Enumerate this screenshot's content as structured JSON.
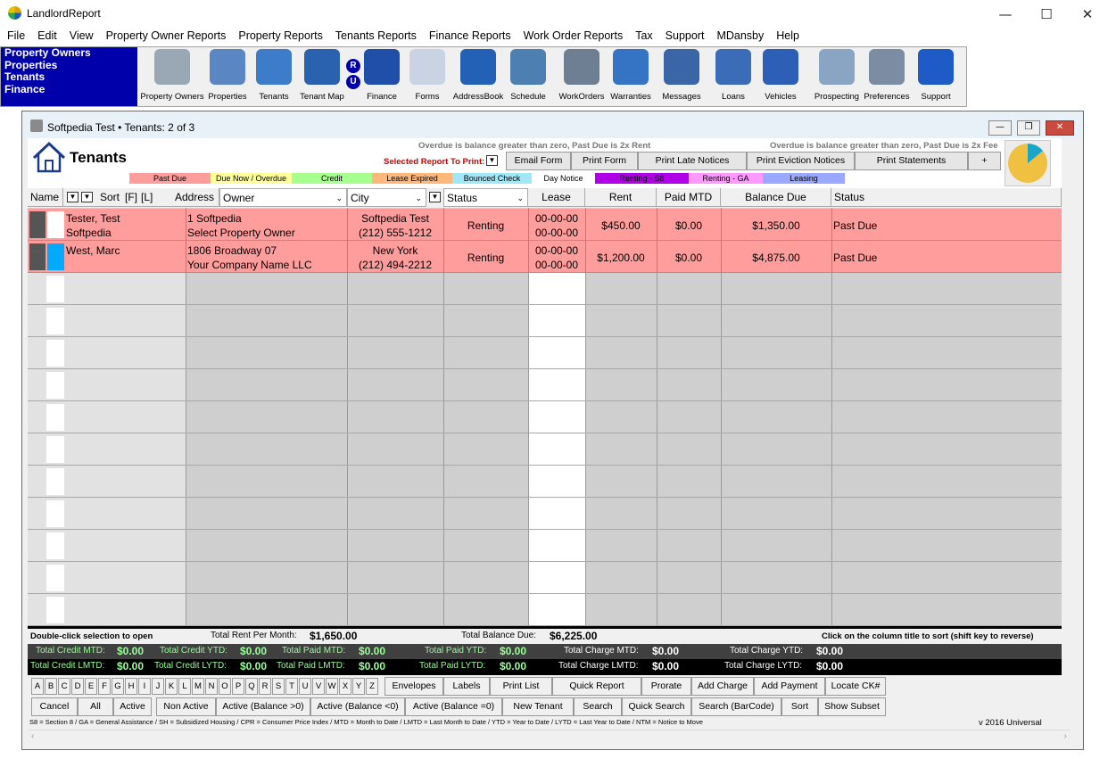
{
  "app": {
    "title": "LandlordReport"
  },
  "menu": [
    "File",
    "Edit",
    "View",
    "Property Owner Reports",
    "Property Reports",
    "Tenants Reports",
    "Finance Reports",
    "Work Order Reports",
    "Tax",
    "Support",
    "MDansby",
    "Help"
  ],
  "nav": [
    "Property Owners",
    "Properties",
    "Tenants",
    "Finance"
  ],
  "toolbar": [
    {
      "label": "Property Owners",
      "icon": "building-icon",
      "color": "#9aa7b4"
    },
    {
      "label": "Properties",
      "icon": "house-icon",
      "color": "#5b86c4"
    },
    {
      "label": "Tenants",
      "icon": "people-icon",
      "color": "#3d7cc9"
    },
    {
      "label": "Tenant Map",
      "icon": "magnifier-icon",
      "color": "#2b62b0"
    },
    {
      "label": "Finance",
      "icon": "bank-icon",
      "color": "#1f4fa8"
    },
    {
      "label": "Forms",
      "icon": "forms-icon",
      "color": "#c9d3e3"
    },
    {
      "label": "AddressBook",
      "icon": "addressbook-icon",
      "color": "#2361b6"
    },
    {
      "label": "Schedule",
      "icon": "calendar-icon",
      "color": "#4d7fb3"
    },
    {
      "label": "WorkOrders",
      "icon": "tools-icon",
      "color": "#6f7f93"
    },
    {
      "label": "Warranties",
      "icon": "warranty-icon",
      "color": "#3574c4"
    },
    {
      "label": "Messages",
      "icon": "phone-icon",
      "color": "#3a66a8"
    },
    {
      "label": "Loans",
      "icon": "hourglass-icon",
      "color": "#3b6cb8"
    },
    {
      "label": "Vehicles",
      "icon": "car-icon",
      "color": "#2c5fb5"
    },
    {
      "label": "Prospecting",
      "icon": "tower-icon",
      "color": "#8aa4c4"
    },
    {
      "label": "Preferences",
      "icon": "wrench-icon",
      "color": "#7b8da3"
    },
    {
      "label": "Support",
      "icon": "help-icon",
      "color": "#1e5bc6"
    }
  ],
  "ru": [
    "R",
    "U"
  ],
  "window": {
    "title": "Softpedia Test  •  Tenants: 2 of 3",
    "heading": "Tenants"
  },
  "notes": {
    "left": "Overdue is balance greater than zero, Past Due is 2x Rent",
    "right": "Overdue is balance greater than zero, Past Due is 2x Fee"
  },
  "selected_report_label": "Selected Report To Print:",
  "print_buttons": [
    "Email Form",
    "Print Form",
    "Print Late Notices",
    "Print Eviction Notices",
    "Print Statements",
    "+"
  ],
  "legend": [
    {
      "label": "Past Due",
      "color": "#ff9d9d"
    },
    {
      "label": "Due Now / Overdue",
      "color": "#ffff99"
    },
    {
      "label": "Credit",
      "color": "#a6ff8f"
    },
    {
      "label": "Lease Expired",
      "color": "#ffb87a"
    },
    {
      "label": "Bounced Check",
      "color": "#a0e8f8"
    },
    {
      "label": "Day Notice",
      "color": "#ffffff"
    },
    {
      "label": "Renting - S8",
      "color": "#b000e8"
    },
    {
      "label": "Renting - GA",
      "color": "#ff99ff"
    },
    {
      "label": "Leasing",
      "color": "#9aa8ff"
    }
  ],
  "columns": {
    "name": "Name",
    "sort": "Sort",
    "sort_f": "[F]",
    "sort_l": "[L]",
    "address": "Address",
    "owner": "Owner",
    "city": "City",
    "status": "Status",
    "lease": "Lease",
    "rent": "Rent",
    "paid_mtd": "Paid MTD",
    "balance_due": "Balance Due",
    "status2": "Status"
  },
  "rows": [
    {
      "name1": "Tester, Test",
      "name2": "Softpedia",
      "addr1": "1 Softpedia",
      "addr2": "Select Property Owner",
      "city1": "Softpedia Test",
      "city2": "(212) 555-1212",
      "status": "Renting",
      "lease1": "00-00-00",
      "lease2": "00-00-00",
      "rent": "$450.00",
      "paid": "$0.00",
      "balance": "$1,350.00",
      "status2": "Past Due"
    },
    {
      "name1": "West, Marc",
      "name2": "",
      "addr1": "1806 Broadway 07",
      "addr2": "Your Company Name LLC",
      "city1": "New York",
      "city2": "(212) 494-2212",
      "status": "Renting",
      "lease1": "00-00-00",
      "lease2": "00-00-00",
      "rent": "$1,200.00",
      "paid": "$0.00",
      "balance": "$4,875.00",
      "status2": "Past Due"
    }
  ],
  "footer": {
    "dbl_click": "Double-click selection to open",
    "total_rent_label": "Total Rent Per Month:",
    "total_rent": "$1,650.00",
    "total_balance_label": "Total Balance Due:",
    "total_balance": "$6,225.00",
    "sort_hint": "Click on the column title to sort (shift key to reverse)",
    "stats1": [
      {
        "label": "Total Credit MTD:",
        "value": "$0.00"
      },
      {
        "label": "Total Credit YTD:",
        "value": "$0.00"
      },
      {
        "label": "Total Paid MTD:",
        "value": "$0.00"
      },
      {
        "label": "Total Paid YTD:",
        "value": "$0.00"
      },
      {
        "label": "Total Charge MTD:",
        "value": "$0.00"
      },
      {
        "label": "Total Charge YTD:",
        "value": "$0.00"
      }
    ],
    "stats2": [
      {
        "label": "Total Credit LMTD:",
        "value": "$0.00"
      },
      {
        "label": "Total Credit LYTD:",
        "value": "$0.00"
      },
      {
        "label": "Total Paid LMTD:",
        "value": "$0.00"
      },
      {
        "label": "Total Paid LYTD:",
        "value": "$0.00"
      },
      {
        "label": "Total Charge LMTD:",
        "value": "$0.00"
      },
      {
        "label": "Total Charge LYTD:",
        "value": "$0.00"
      }
    ],
    "letters": [
      "A",
      "B",
      "C",
      "D",
      "E",
      "F",
      "G",
      "H",
      "I",
      "J",
      "K",
      "L",
      "M",
      "N",
      "O",
      "P",
      "Q",
      "R",
      "S",
      "T",
      "U",
      "V",
      "W",
      "X",
      "Y",
      "Z"
    ],
    "row1_buttons": [
      "Envelopes",
      "Labels",
      "Print List",
      "Quick Report",
      "Prorate",
      "Add Charge",
      "Add Payment",
      "Locate CK#"
    ],
    "row2_buttons": [
      "Cancel",
      "All",
      "Active",
      "Non Active",
      "Active (Balance >0)",
      "Active (Balance <0)",
      "Active (Balance =0)",
      "New Tenant",
      "Search",
      "Quick Search",
      "Search (BarCode)",
      "Sort",
      "Show Subset"
    ],
    "abbrev": "S8 = Section 8  /  GA = General Assistance  /  SH = Subsidized Housing  /  CPR = Consumer Price Index  /  MTD = Month to Date  /  LMTD = Last Month to Date  /  YTD = Year to Date  /  LYTD = Last Year to Date  /  NTM = Notice to Move",
    "version": "v 2016 Universal"
  }
}
